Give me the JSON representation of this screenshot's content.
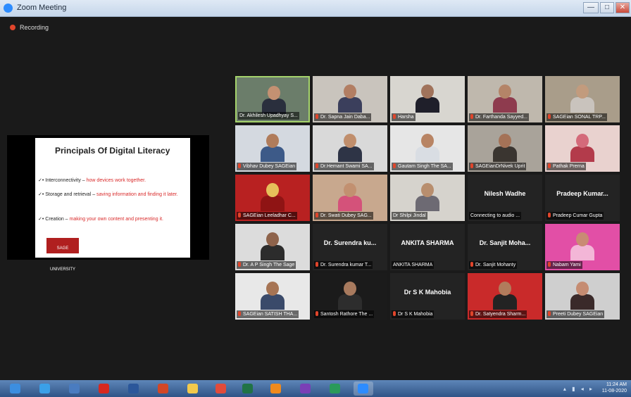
{
  "window": {
    "title": "Zoom Meeting",
    "controls": {
      "minimize": "—",
      "maximize": "□",
      "close": "✕"
    }
  },
  "recording": {
    "label": "Recording",
    "color": "#e0452b"
  },
  "shared_slide": {
    "title": "Principals Of Digital Literacy",
    "bullets": [
      {
        "term": "Interconnectivity – ",
        "detail": "how devices work together."
      },
      {
        "term": "Storage and retrieval – ",
        "detail": "saving information and finding it later."
      },
      {
        "term": "Creation – ",
        "detail": "making your own content and presenting it."
      }
    ],
    "logo_text": "SAGE UNIVERSITY"
  },
  "participants": [
    {
      "caption": "Dr. Akhilesh Upadhyay S...",
      "video": true,
      "active": true,
      "muted": false,
      "bg": "#6b7d6a",
      "skin": "#c49172",
      "cloth": "#2a2f3d"
    },
    {
      "caption": "Dr. Sapna Jain Daba...",
      "video": true,
      "active": false,
      "muted": true,
      "bg": "#c9c4bd",
      "skin": "#b27e63",
      "cloth": "#3b3f5c"
    },
    {
      "caption": "Harsha",
      "video": true,
      "active": false,
      "muted": true,
      "bg": "#d8d6d0",
      "skin": "#a0735b",
      "cloth": "#1f1f2a"
    },
    {
      "caption": "Dr. Farthanda Sayyed...",
      "video": true,
      "active": false,
      "muted": true,
      "bg": "#bfb8ad",
      "skin": "#b48468",
      "cloth": "#8e3b4e"
    },
    {
      "caption": "SAGEian SONAL TRP...",
      "video": true,
      "active": false,
      "muted": true,
      "bg": "#a99d8a",
      "skin": "#c29b7d",
      "cloth": "#c9c3bd"
    },
    {
      "caption": "Vibhav Dubey SAGEian",
      "video": true,
      "active": false,
      "muted": true,
      "bg": "#d4d9e0",
      "skin": "#b07c5b",
      "cloth": "#3d5a88"
    },
    {
      "caption": "Dr.Hemant Swami SA...",
      "video": true,
      "active": false,
      "muted": true,
      "bg": "#d9d9d9",
      "skin": "#c08e6c",
      "cloth": "#2e3446"
    },
    {
      "caption": "Gautam Singh The SA...",
      "video": true,
      "active": false,
      "muted": true,
      "bg": "#e6e6e6",
      "skin": "#b88464",
      "cloth": "#d9dde3"
    },
    {
      "caption": "SAGEianDrNivek Uprit",
      "video": true,
      "active": false,
      "muted": true,
      "bg": "#a9a39a",
      "skin": "#a47257",
      "cloth": "#3a3530"
    },
    {
      "caption": "Pathak Prerna",
      "video": true,
      "active": false,
      "muted": true,
      "bg": "#e9d2cf",
      "skin": "#d46a7a",
      "cloth": "#b33b4b"
    },
    {
      "caption": "SAGEian Leeladhar C...",
      "video": true,
      "active": false,
      "muted": true,
      "bg": "#b82121",
      "skin": "#e6c05a",
      "cloth": "#8f1414"
    },
    {
      "caption": "Dr. Swati Dubey SAG...",
      "video": true,
      "active": false,
      "muted": true,
      "bg": "#c8a88e",
      "skin": "#c29070",
      "cloth": "#d4527a"
    },
    {
      "caption": "Dr Shilpi Jindal",
      "video": true,
      "active": false,
      "muted": false,
      "bg": "#d6d3cd",
      "skin": "#b88e6e",
      "cloth": "#6d6a73"
    },
    {
      "caption": "Connecting to audio ...",
      "name": "Nilesh Wadhe",
      "video": false,
      "active": false,
      "muted": false
    },
    {
      "caption": "Pradeep Cumar Gupta",
      "name": "Pradeep Kumar...",
      "video": false,
      "active": false,
      "muted": true
    },
    {
      "caption": "Dr. A P Singh The Sage",
      "video": true,
      "active": false,
      "muted": true,
      "bg": "#dcdcdc",
      "skin": "#8e634b",
      "cloth": "#2c2c2c"
    },
    {
      "caption": "Dr. Surendra kumar T...",
      "name": "Dr. Surendra ku...",
      "video": false,
      "active": false,
      "muted": true
    },
    {
      "caption": "ANKITA SHARMA",
      "name": "ANKITA SHARMA",
      "video": false,
      "active": false,
      "muted": false
    },
    {
      "caption": "Dr. Sanjit Mohanty",
      "name": "Dr. Sanjit Moha...",
      "video": false,
      "active": false,
      "muted": true
    },
    {
      "caption": "Nabam Yami",
      "video": true,
      "active": false,
      "muted": true,
      "bg": "#e24fa6",
      "skin": "#c98b74",
      "cloth": "#f3b6d7"
    },
    {
      "caption": "SAGEian SATISH THA...",
      "video": true,
      "active": false,
      "muted": true,
      "bg": "#e8e8e8",
      "skin": "#a67454",
      "cloth": "#3a4a6a"
    },
    {
      "caption": "Santosh Rathore The ...",
      "video": true,
      "active": false,
      "muted": true,
      "bg": "#1b1b1b",
      "skin": "#a87a5e",
      "cloth": "#2d2d2d"
    },
    {
      "caption": "Dr S K Mahobia",
      "name": "Dr S K Mahobia",
      "video": false,
      "active": false,
      "muted": true
    },
    {
      "caption": "Dr. Satyendra Sharm...",
      "video": true,
      "active": false,
      "muted": true,
      "bg": "#c92a2a",
      "skin": "#b17c5c",
      "cloth": "#232323"
    },
    {
      "caption": "Preeti Dubey SAGEian",
      "video": true,
      "active": false,
      "muted": true,
      "bg": "#cfcfcf",
      "skin": "#c58c72",
      "cloth": "#3a2a2a"
    }
  ],
  "taskbar": {
    "apps": [
      {
        "icon": "windows-start-icon",
        "color": "#3c8ee0"
      },
      {
        "icon": "internet-explorer-icon",
        "color": "#3aa0e8"
      },
      {
        "icon": "media-player-icon",
        "color": "#4a7cc0"
      },
      {
        "icon": "acrobat-reader-icon",
        "color": "#d8281f"
      },
      {
        "icon": "word-document-icon",
        "color": "#2b579a"
      },
      {
        "icon": "powerpoint-icon",
        "color": "#d24726"
      },
      {
        "icon": "file-explorer-icon",
        "color": "#f2c94c"
      },
      {
        "icon": "chrome-icon",
        "color": "#e24b3b"
      },
      {
        "icon": "excel-icon",
        "color": "#217346"
      },
      {
        "icon": "vlc-icon",
        "color": "#f08a1e"
      },
      {
        "icon": "app-badge-purple-icon",
        "color": "#7a3fb6"
      },
      {
        "icon": "app-badge-green-icon",
        "color": "#2a9a5a"
      },
      {
        "icon": "zoom-icon",
        "color": "#2d8cff"
      }
    ],
    "tray": "▴ ▮ ◂ ▸",
    "time": "11:24 AM",
    "date": "11-08-2020"
  }
}
